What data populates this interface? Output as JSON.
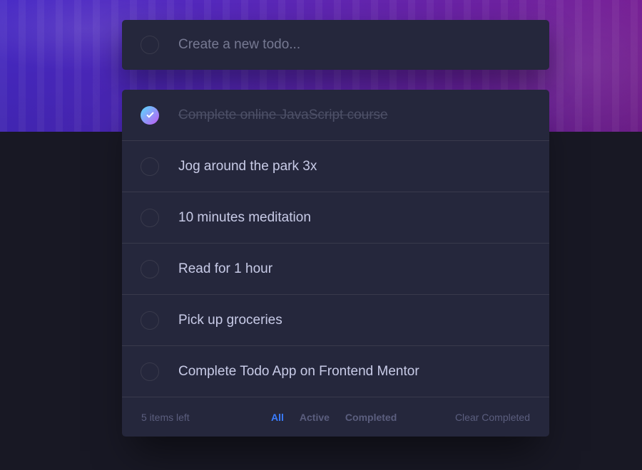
{
  "new_todo": {
    "placeholder": "Create a new todo..."
  },
  "todos": [
    {
      "text": "Complete online JavaScript course",
      "completed": true
    },
    {
      "text": "Jog around the park 3x",
      "completed": false
    },
    {
      "text": "10 minutes meditation",
      "completed": false
    },
    {
      "text": "Read for 1 hour",
      "completed": false
    },
    {
      "text": "Pick up groceries",
      "completed": false
    },
    {
      "text": "Complete Todo App on Frontend Mentor",
      "completed": false
    }
  ],
  "footer": {
    "items_left": "5 items left",
    "filters": [
      "All",
      "Active",
      "Completed"
    ],
    "active_filter": "All",
    "clear_label": "Clear Completed"
  },
  "colors": {
    "accent": "#3a7cfd",
    "check_gradient_start": "#57ddff",
    "check_gradient_end": "#c058f3",
    "card": "#25273c",
    "background": "#181824"
  },
  "icons": {
    "check": "check-icon"
  }
}
